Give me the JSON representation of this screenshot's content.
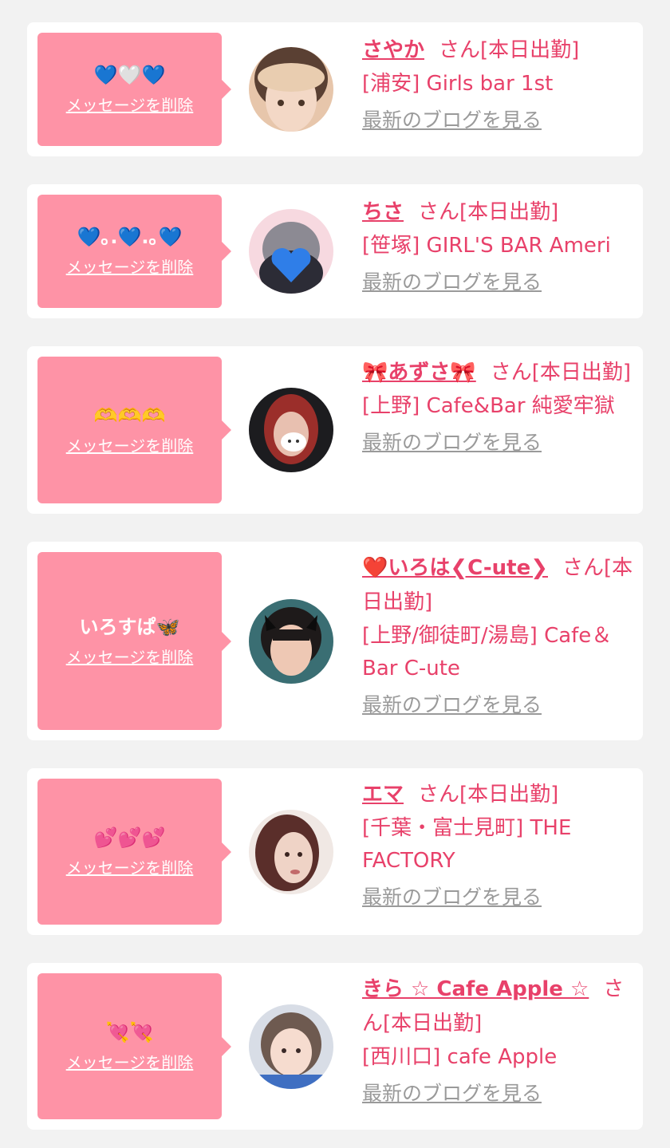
{
  "delete_label": "メッセージを削除",
  "blog_label": "最新のブログを見る",
  "colors": {
    "tag_bg": "#fe93a6",
    "accent": "#e8416a",
    "link_gray": "#9a9a9a"
  },
  "cards": [
    {
      "title": "💙🤍💙",
      "name": "さやか",
      "suffix": "さん[本日出勤]",
      "shop": "[浦安] Girls bar 1st"
    },
    {
      "title": "💙｡.💙.｡💙",
      "name": "ちさ",
      "suffix": "さん[本日出勤]",
      "shop": "[笹塚] GIRL'S BAR Ameri"
    },
    {
      "title": "🫶🫶🫶",
      "name": "🎀あずさ🎀",
      "suffix": "さん[本日出勤]",
      "shop": "[上野] Cafe&Bar 純愛牢獄"
    },
    {
      "title": "いろすぱ🦋",
      "name": "❤️いろは❮C-ute❯",
      "suffix": "さん[本日出勤]",
      "shop": "[上野/御徒町/湯島] Cafe＆Bar C-ute"
    },
    {
      "title": "💕💕💕",
      "name": "エマ",
      "suffix": "さん[本日出勤]",
      "shop": "[千葉・富士見町] THE FACTORY"
    },
    {
      "title": "💘💘",
      "name": "きら ☆ Cafe Apple ☆",
      "suffix": "さん[本日出勤]",
      "shop": "[西川口] cafe Apple"
    }
  ]
}
